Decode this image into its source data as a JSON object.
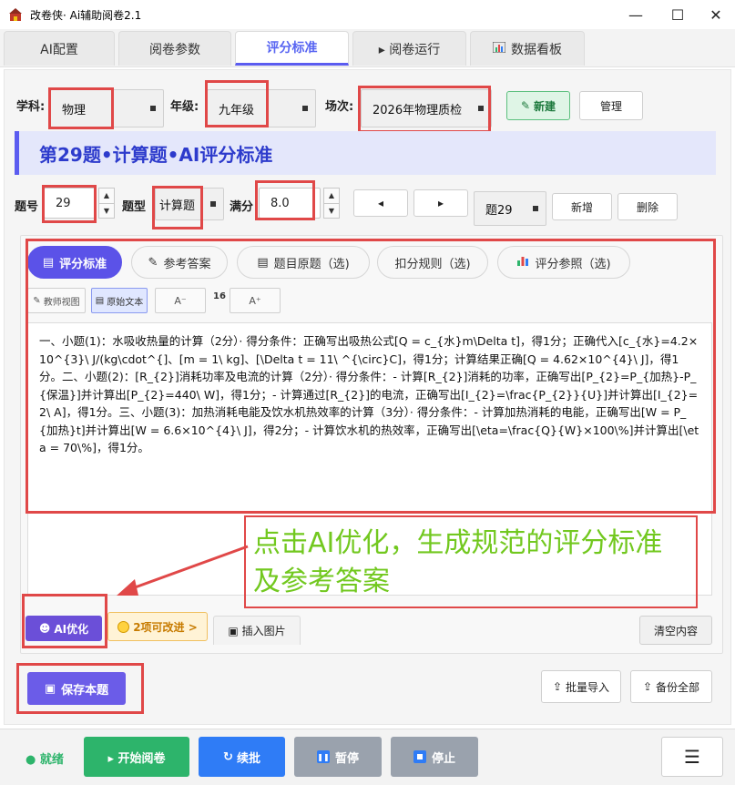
{
  "window": {
    "title": "改卷侠· Ai辅助阅卷2.1",
    "minimize": "—",
    "maximize": "☐",
    "close": "✕"
  },
  "tabs": [
    {
      "label": "AI配置"
    },
    {
      "label": "阅卷参数"
    },
    {
      "label": "评分标准",
      "active": true
    },
    {
      "label": "▸ 阅卷运行"
    },
    {
      "label": "数据看板"
    }
  ],
  "filters": {
    "subject_label": "学科:",
    "subject_value": "物理",
    "grade_label": "年级:",
    "grade_value": "九年级",
    "session_label": "场次:",
    "session_value": "2026年物理质检",
    "new_button": "新建",
    "manage_button": "管理"
  },
  "banner": {
    "title": "第29题•计算题•AI评分标准"
  },
  "question": {
    "number_label": "题号",
    "number_value": "29",
    "type_label": "题型",
    "type_value": "计算题",
    "score_label": "满分",
    "score_value": "8.0",
    "prev_button": "◂",
    "next_button": "▸",
    "current_select": "题29",
    "add_button": "新增",
    "delete_button": "删除"
  },
  "subtabs": [
    {
      "label": "评分标准",
      "active": true
    },
    {
      "label": "参考答案"
    },
    {
      "label": "题目原题（选)"
    },
    {
      "label": "扣分规则（选)"
    },
    {
      "label": "评分参照（选)"
    }
  ],
  "view_controls": {
    "teacher_view": "教师视图",
    "raw_text": "原始文本",
    "font_decrease": "A⁻",
    "font_size": "16",
    "font_increase": "A⁺"
  },
  "editor": {
    "content": "一、小题(1)：水吸收热量的计算（2分）· 得分条件：正确写出吸热公式[Q = c_{水}m\\Delta t]，得1分；正确代入[c_{水}=4.2×10^{3}\\ J/(kg\\cdot^{]、[m = 1\\ kg]、[\\Delta t = 11\\ ^{\\circ}C]，得1分；计算结果正确[Q = 4.62×10^{4}\\ J]，得1分。二、小题(2)：[R_{2}]消耗功率及电流的计算（2分）· 得分条件：- 计算[R_{2}]消耗的功率，正确写出[P_{2}=P_{加热}-P_{保温}]并计算出[P_{2}=440\\ W]，得1分；- 计算通过[R_{2}]的电流，正确写出[I_{2}=\\frac{P_{2}}{U}]并计算出[I_{2}=2\\ A]，得1分。三、小题(3)：加热消耗电能及饮水机热效率的计算（3分）· 得分条件：- 计算加热消耗的电能，正确写出[W = P_{加热}t]并计算出[W = 6.6×10^{4}\\ J]，得2分；- 计算饮水机的热效率，正确写出[\\eta=\\frac{Q}{W}×100\\%]并计算出[\\eta = 70\\%]，得1分。"
  },
  "annotation": {
    "callout_line1": "点击AI优化，生成规范的评分标准",
    "callout_line2": "及参考答案"
  },
  "editor_actions": {
    "ai_optimize": "AI优化",
    "improvements": "2项可改进 >",
    "insert_image": "插入图片",
    "clear": "清空内容"
  },
  "save_row": {
    "save_button": "保存本题",
    "batch_import": "批量导入",
    "backup_all": "备份全部"
  },
  "bottom": {
    "status": "● 就绪",
    "start": "▸ 开始阅卷",
    "resume": "续批",
    "pause": "暂停",
    "stop": "停止",
    "menu": "☰"
  },
  "colors": {
    "accent": "#5b5cf0",
    "red_highlight": "#e04848",
    "callout_green": "#72c81f",
    "start_green": "#2db46b",
    "resume_blue": "#2f7cf6",
    "disabled_gray": "#9aa2ad"
  }
}
